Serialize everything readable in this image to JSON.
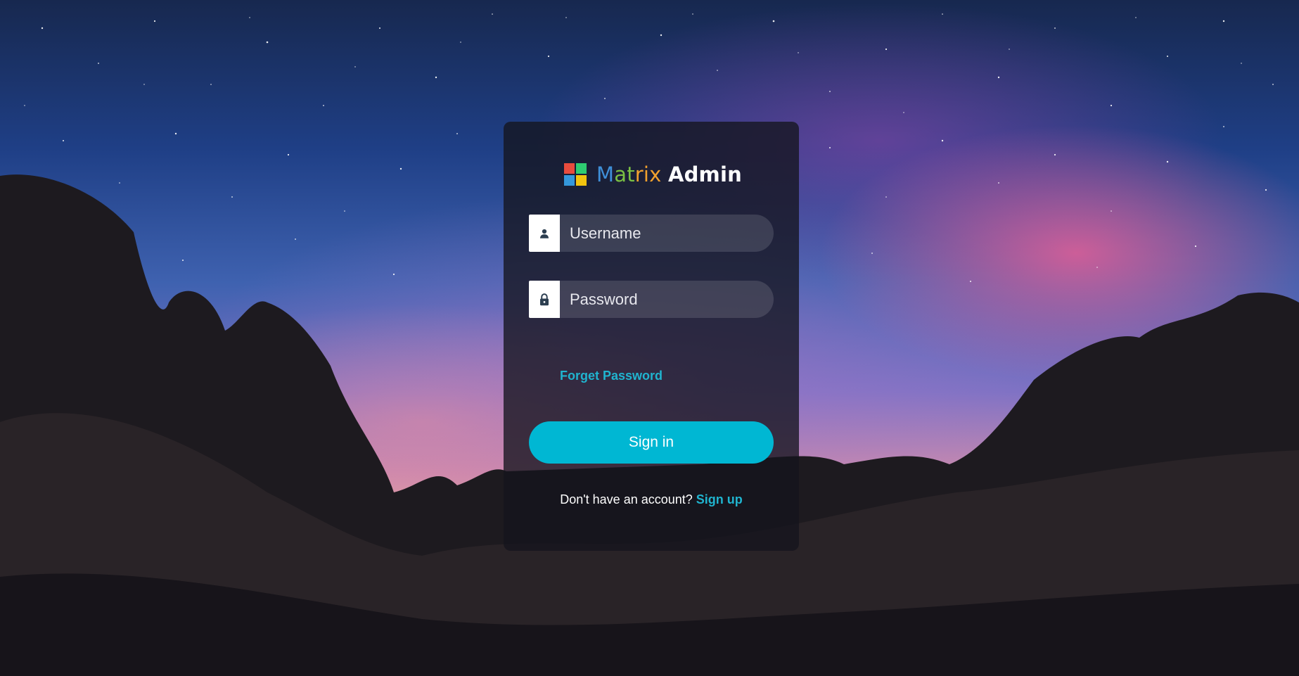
{
  "brand": {
    "name_part1": "M",
    "name_part2": "at",
    "name_part3": "rix",
    "name_part4": "Admin",
    "logo_colors": [
      "#e84c3d",
      "#2ecc71",
      "#3498db",
      "#f1c40f"
    ]
  },
  "login": {
    "username_placeholder": "Username",
    "password_placeholder": "Password",
    "username_icon": "user-icon",
    "password_icon": "lock-icon",
    "forget_label": "Forget Password",
    "signin_label": "Sign in",
    "signup_prompt": "Don't have an account?",
    "signup_label": "Sign up"
  },
  "colors": {
    "accent": "#00b7d3",
    "link": "#20b4cf",
    "card_bg": "rgba(20,20,30,0.78)"
  }
}
